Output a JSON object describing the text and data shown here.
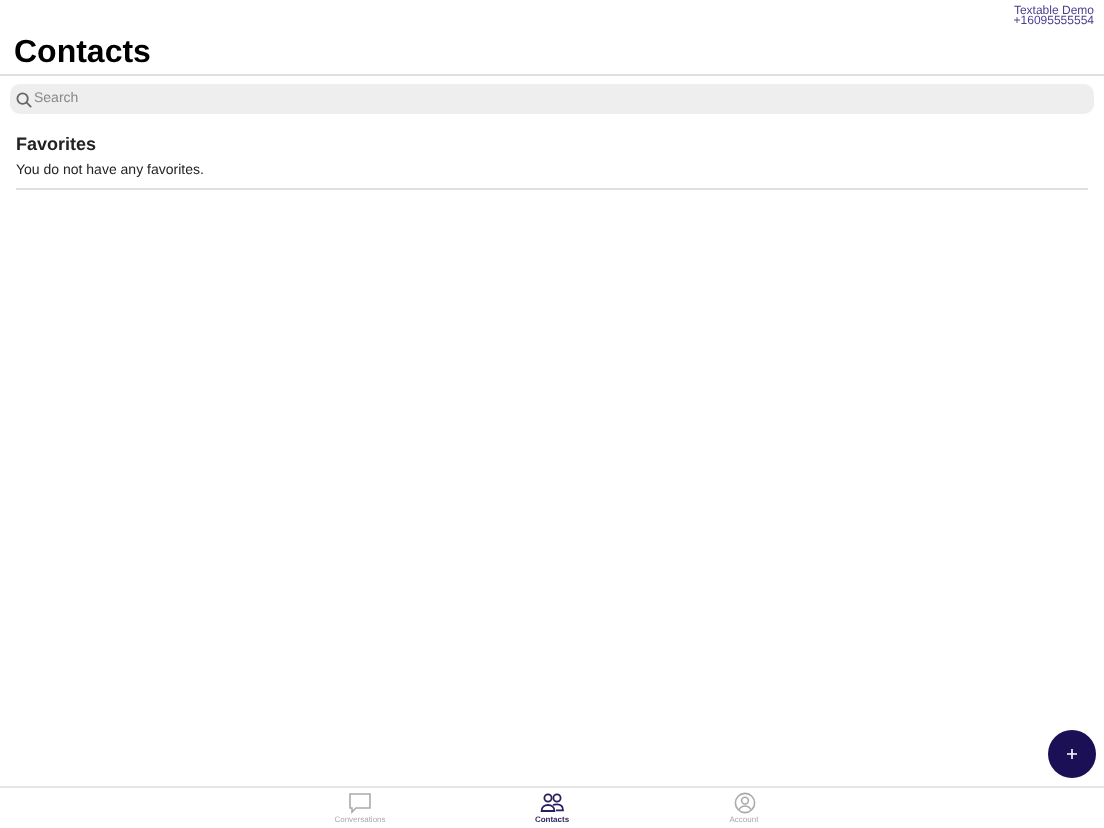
{
  "account": {
    "name": "Textable Demo",
    "phone": "+16095555554"
  },
  "title": "Contacts",
  "search": {
    "placeholder": "Search"
  },
  "favorites": {
    "heading": "Favorites",
    "empty_text": "You do not have any favorites."
  },
  "tabs": [
    {
      "label": "Conversations",
      "kind": "chat",
      "selected": false
    },
    {
      "label": "Contacts",
      "kind": "people",
      "selected": true
    },
    {
      "label": "Account",
      "kind": "account",
      "selected": false
    }
  ]
}
